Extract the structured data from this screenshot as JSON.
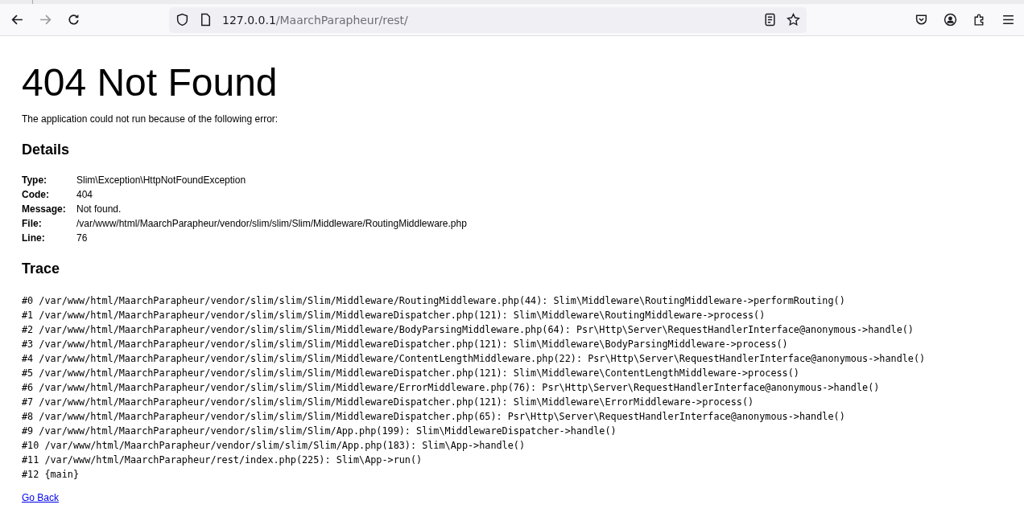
{
  "browser": {
    "url_host": "127.0.0.1",
    "url_path": "/MaarchParapheur/rest/"
  },
  "page": {
    "title": "404 Not Found",
    "intro": "The application could not run because of the following error:",
    "details_heading": "Details",
    "details": [
      {
        "label": "Type:",
        "value": "Slim\\Exception\\HttpNotFoundException"
      },
      {
        "label": "Code:",
        "value": "404"
      },
      {
        "label": "Message:",
        "value": "Not found."
      },
      {
        "label": "File:",
        "value": "/var/www/html/MaarchParapheur/vendor/slim/slim/Slim/Middleware/RoutingMiddleware.php"
      },
      {
        "label": "Line:",
        "value": "76"
      }
    ],
    "trace_heading": "Trace",
    "trace": [
      "#0 /var/www/html/MaarchParapheur/vendor/slim/slim/Slim/Middleware/RoutingMiddleware.php(44): Slim\\Middleware\\RoutingMiddleware->performRouting()",
      "#1 /var/www/html/MaarchParapheur/vendor/slim/slim/Slim/MiddlewareDispatcher.php(121): Slim\\Middleware\\RoutingMiddleware->process()",
      "#2 /var/www/html/MaarchParapheur/vendor/slim/slim/Slim/Middleware/BodyParsingMiddleware.php(64): Psr\\Http\\Server\\RequestHandlerInterface@anonymous->handle()",
      "#3 /var/www/html/MaarchParapheur/vendor/slim/slim/Slim/MiddlewareDispatcher.php(121): Slim\\Middleware\\BodyParsingMiddleware->process()",
      "#4 /var/www/html/MaarchParapheur/vendor/slim/slim/Slim/Middleware/ContentLengthMiddleware.php(22): Psr\\Http\\Server\\RequestHandlerInterface@anonymous->handle()",
      "#5 /var/www/html/MaarchParapheur/vendor/slim/slim/Slim/MiddlewareDispatcher.php(121): Slim\\Middleware\\ContentLengthMiddleware->process()",
      "#6 /var/www/html/MaarchParapheur/vendor/slim/slim/Slim/Middleware/ErrorMiddleware.php(76): Psr\\Http\\Server\\RequestHandlerInterface@anonymous->handle()",
      "#7 /var/www/html/MaarchParapheur/vendor/slim/slim/Slim/MiddlewareDispatcher.php(121): Slim\\Middleware\\ErrorMiddleware->process()",
      "#8 /var/www/html/MaarchParapheur/vendor/slim/slim/Slim/MiddlewareDispatcher.php(65): Psr\\Http\\Server\\RequestHandlerInterface@anonymous->handle()",
      "#9 /var/www/html/MaarchParapheur/vendor/slim/slim/Slim/App.php(199): Slim\\MiddlewareDispatcher->handle()",
      "#10 /var/www/html/MaarchParapheur/vendor/slim/slim/Slim/App.php(183): Slim\\App->handle()",
      "#11 /var/www/html/MaarchParapheur/rest/index.php(225): Slim\\App->run()",
      "#12 {main}"
    ],
    "back_link": "Go Back"
  }
}
